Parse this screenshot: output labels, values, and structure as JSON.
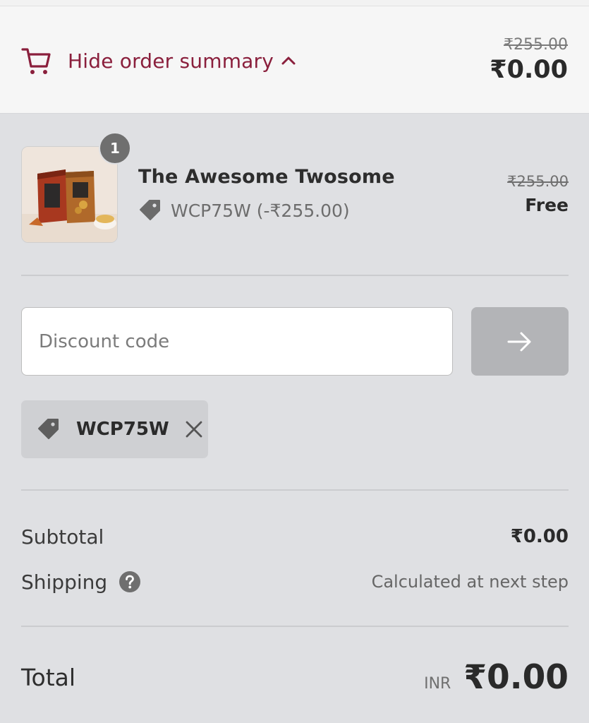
{
  "header": {
    "toggle_label": "Hide order summary",
    "compare_at_total": "₹255.00",
    "total": "₹0.00"
  },
  "line_item": {
    "quantity": "1",
    "title": "The Awesome Twosome",
    "discount": "WCP75W (-₹255.00)",
    "compare_at_price": "₹255.00",
    "price": "Free"
  },
  "discount_form": {
    "placeholder": "Discount code",
    "value": ""
  },
  "applied_discount": {
    "code": "WCP75W"
  },
  "summary": {
    "subtotal_label": "Subtotal",
    "subtotal_value": "₹0.00",
    "shipping_label": "Shipping",
    "shipping_value": "Calculated at next step",
    "total_label": "Total",
    "currency": "INR",
    "total_value": "₹0.00"
  },
  "colors": {
    "accent": "#8a1f3c",
    "panel_bg": "#dfe0e3",
    "header_bg": "#f6f6f6",
    "apply_button_bg": "#b3b4b7"
  },
  "icons": [
    "cart-icon",
    "chevron-up-icon",
    "tag-icon",
    "arrow-right-icon",
    "close-icon",
    "help-icon"
  ]
}
